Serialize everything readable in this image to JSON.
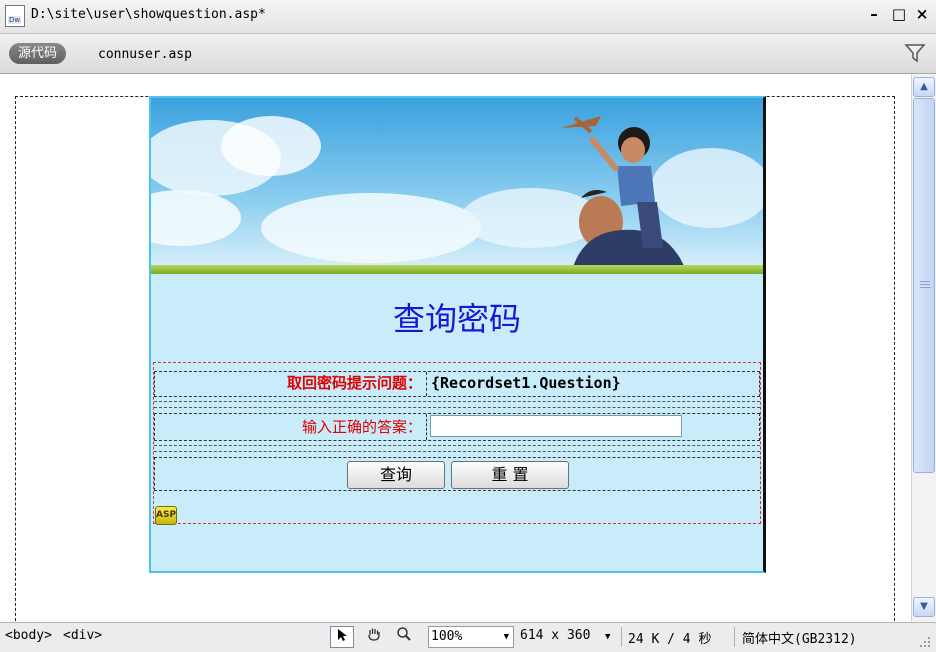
{
  "window": {
    "title": "D:\\site\\user\\showquestion.asp*",
    "doc_icon_label": "Dw",
    "minimize_label": "–",
    "maximize_label": "□",
    "close_label": "×"
  },
  "toolbar": {
    "source_code_label": "源代码",
    "related_file": "connuser.asp"
  },
  "page": {
    "heading": "查询密码",
    "question_label": "取回密码提示问题：",
    "question_value": "{Recordset1.Question}",
    "answer_label": "输入正确的答案：",
    "answer_value": "",
    "query_button": "查询",
    "reset_button": "重  置",
    "asp_marker": "ASP"
  },
  "statusbar": {
    "tag_body": "<body>",
    "tag_div": "<div>",
    "zoom": "100%",
    "dimensions": "614 x 360",
    "file_size": "24 K / 4 秒",
    "encoding": "简体中文(GB2312)"
  },
  "colors": {
    "banner_sky": "#6cbfe8",
    "content_bg": "#c9ecfa",
    "heading": "#1717d6",
    "label_red": "#e00000"
  }
}
